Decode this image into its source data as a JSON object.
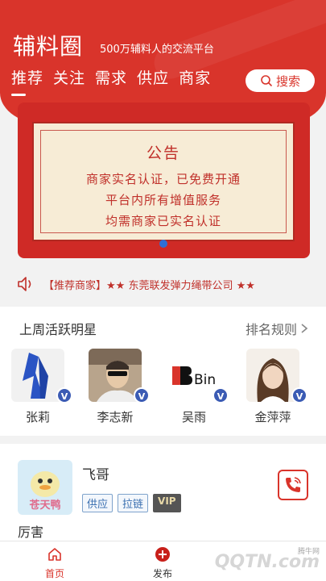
{
  "header": {
    "title": "辅料圈",
    "slogan": "500万辅料人的交流平台",
    "tabs": [
      "推荐",
      "关注",
      "需求",
      "供应",
      "商家"
    ],
    "search_label": "搜索"
  },
  "banner": {
    "title": "公告",
    "lines": [
      "商家实名认证，已免费开通",
      "平台内所有增值服务",
      "均需商家已实名认证"
    ]
  },
  "ticker": {
    "text": "【推荐商家】★★ 东莞联发弹力绳带公司 ★★"
  },
  "stars": {
    "title": "上周活跃明星",
    "rule_label": "排名规则",
    "users": [
      {
        "name": "张莉",
        "badge": "V"
      },
      {
        "name": "李志新",
        "badge": "V"
      },
      {
        "name": "吴雨",
        "badge": "V"
      },
      {
        "name": "金萍萍",
        "badge": "V"
      }
    ],
    "logo_text": "Bin"
  },
  "post": {
    "name": "飞哥",
    "tags": [
      "供应",
      "拉链"
    ],
    "vip": "VIP",
    "avatar_text": "苍天鸭",
    "text": "厉害"
  },
  "nav": {
    "home": "首页",
    "publish": "发布"
  },
  "watermark": {
    "text": "QQTN.com",
    "small": "腾牛网"
  },
  "colors": {
    "brand": "#d9342b",
    "badge": "#3b5bb4"
  }
}
